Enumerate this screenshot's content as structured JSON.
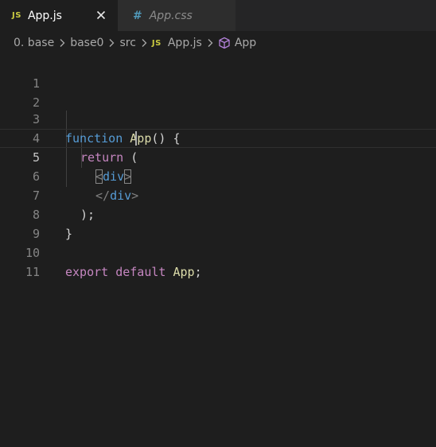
{
  "tabs": [
    {
      "icon": "JS",
      "label": "App.js",
      "active": true,
      "close": "×"
    },
    {
      "icon": "#",
      "label": "App.css",
      "active": false
    }
  ],
  "breadcrumb": {
    "items": [
      "0. base",
      "base0",
      "src",
      "App.js",
      "App"
    ],
    "file_icon": "JS"
  },
  "editor": {
    "current_line": 5,
    "line_numbers": [
      "1",
      "2",
      "3",
      "4",
      "5",
      "6",
      "7",
      "8",
      "9",
      "10",
      "11"
    ],
    "code": {
      "l3_function": "function",
      "l3_name": "App",
      "l3_rest": "() {",
      "l4_return": "return",
      "l4_paren": "(",
      "l5_open": "<",
      "l5_tag": "div",
      "l5_close": ">",
      "l6_open": "</",
      "l6_tag": "div",
      "l6_close": ">",
      "l7_text": ");",
      "l8_text": "}",
      "l10_export": "export",
      "l10_default": "default",
      "l10_name": "App",
      "l10_semi": ";"
    }
  },
  "colors": {
    "background": "#1e1e1e",
    "tabbar": "#252526",
    "js_icon": "#cbcb41",
    "css_icon": "#519aba",
    "keyword_control": "#c586c0",
    "keyword": "#569cd6",
    "function": "#dcdcaa",
    "symbol_icon": "#b180d7"
  }
}
